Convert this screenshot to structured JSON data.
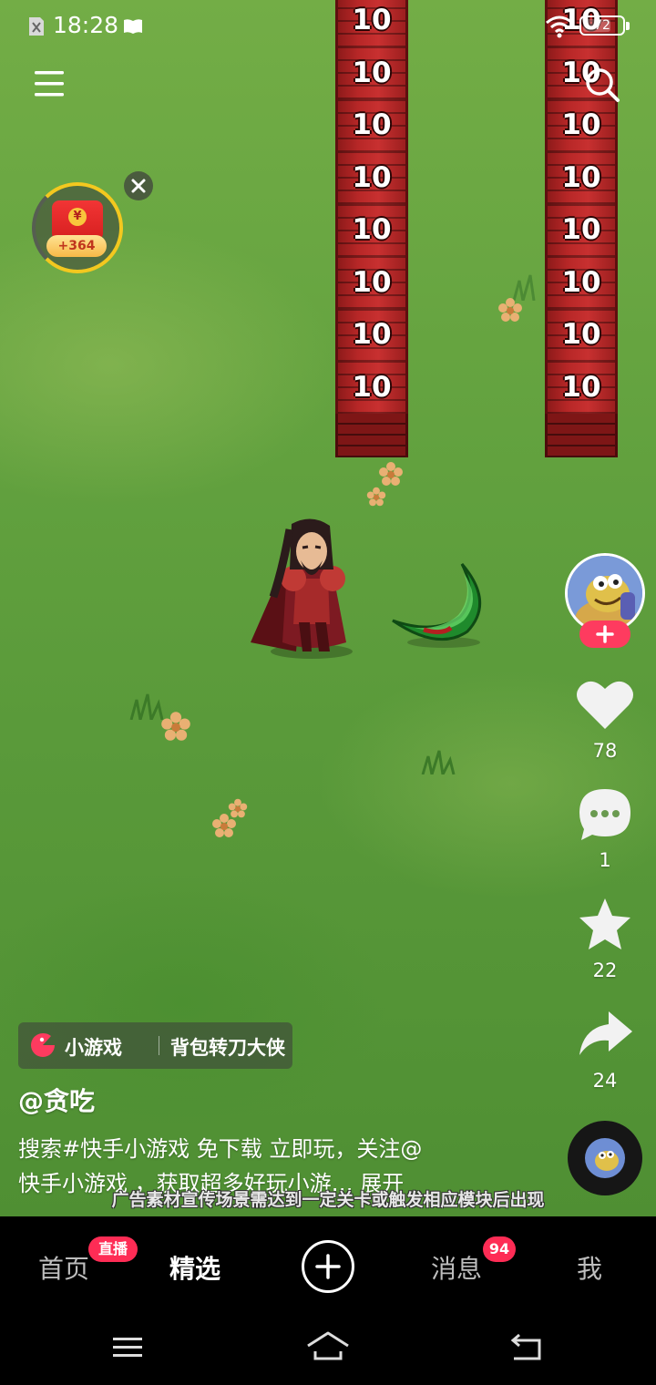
{
  "status_bar": {
    "time": "18:28",
    "battery": "72",
    "battery_level": 0.72
  },
  "game": {
    "pillars": [
      {
        "cells": [
          "10",
          "10",
          "10",
          "10",
          "10",
          "10",
          "10",
          "10"
        ]
      },
      {
        "cells": [
          "10",
          "10",
          "10",
          "10",
          "10",
          "10",
          "10",
          "10"
        ]
      }
    ]
  },
  "red_packet": {
    "bonus": "+364",
    "coin": "¥"
  },
  "actions": {
    "likes": "78",
    "comments": "1",
    "favorites": "22",
    "shares": "24"
  },
  "caption": {
    "tag_label": "小游戏",
    "tag_game_name": "背包转刀大侠",
    "author": "@贪吃",
    "line1": "搜索#快手小游戏 免下载 立即玩，关注@",
    "line2": "快手小游戏 ，获取超多好玩小游… 展开",
    "ad_disclaimer": "广告素材宣传场景需达到一定关卡或触发相应模块后出现"
  },
  "bottom_nav": {
    "home": "首页",
    "home_badge": "直播",
    "featured": "精选",
    "messages": "消息",
    "messages_badge": "94",
    "me": "我"
  },
  "colors": {
    "accent": "#fe2c55",
    "pillar": "#b72727",
    "grass": "#63a23f"
  }
}
